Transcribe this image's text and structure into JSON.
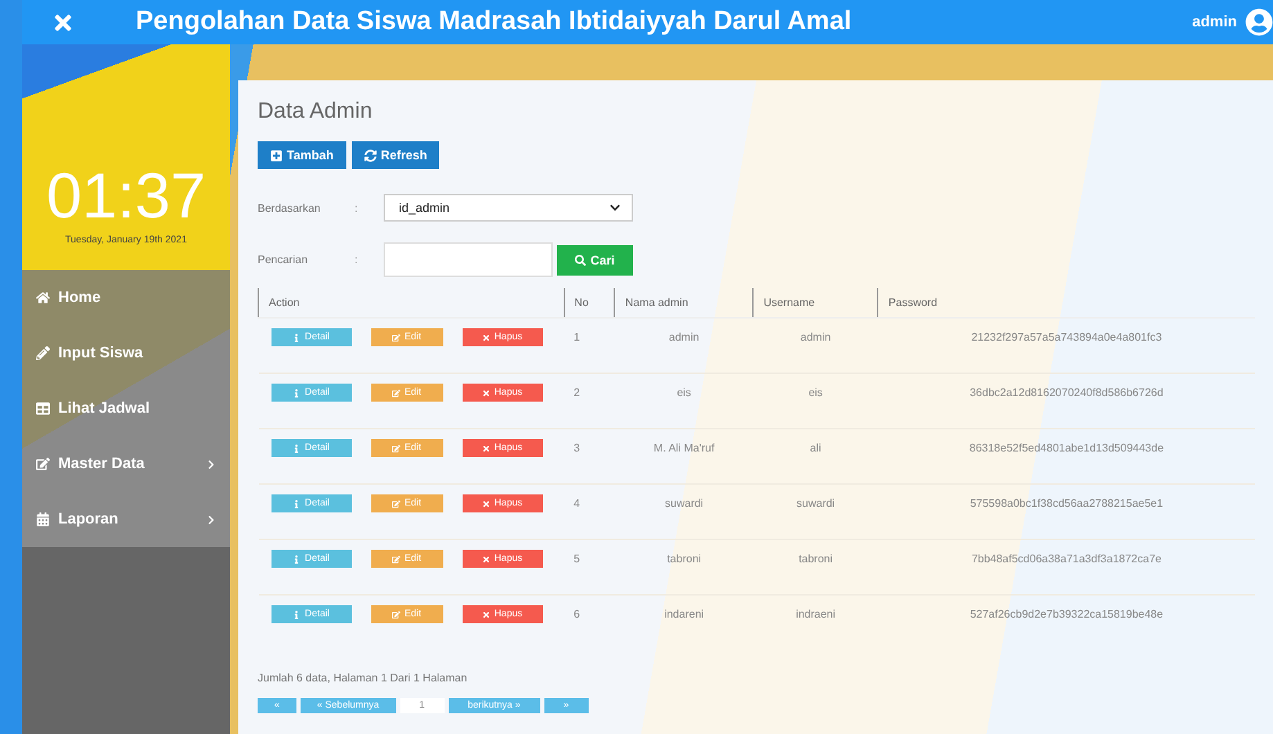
{
  "header": {
    "title": "Pengolahan Data Siswa Madrasah Ibtidaiyyah Darul Amal",
    "user": "admin"
  },
  "sidebar": {
    "clock": {
      "time": "01:37",
      "date": "Tuesday, January 19th 2021"
    },
    "items": [
      {
        "label": "Home",
        "submenu": false
      },
      {
        "label": "Input Siswa",
        "submenu": false
      },
      {
        "label": "Lihat Jadwal",
        "submenu": false
      },
      {
        "label": "Master Data",
        "submenu": true
      },
      {
        "label": "Laporan",
        "submenu": true
      }
    ]
  },
  "page_title": "Data Admin",
  "toolbar": [
    {
      "label": "Tambah",
      "kind": "add"
    },
    {
      "label": "Refresh",
      "kind": "refresh"
    }
  ],
  "filter": {
    "label": "Berdasarkan",
    "separator": ":",
    "value": "id_admin"
  },
  "search": {
    "label": "Pencarian",
    "separator": ":",
    "button": "Cari"
  },
  "table": {
    "columns": [
      "Action",
      "No",
      "Nama admin",
      "Username",
      "Password"
    ],
    "rows": [
      {
        "actions": [
          "Detail",
          "Edit",
          "Hapus"
        ],
        "no": "1",
        "name": "admin",
        "username": "admin",
        "password": "21232f297a57a5a743894a0e4a801fc3"
      },
      {
        "actions": [
          "Detail",
          "Edit",
          "Hapus"
        ],
        "no": "2",
        "name": "eis",
        "username": "eis",
        "password": "36dbc2a12d8162070240f8d586b6726d"
      },
      {
        "actions": [
          "Detail",
          "Edit",
          "Hapus"
        ],
        "no": "3",
        "name": "M. Ali Ma'ruf",
        "username": "ali",
        "password": "86318e52f5ed4801abe1d13d509443de"
      },
      {
        "actions": [
          "Detail",
          "Edit",
          "Hapus"
        ],
        "no": "4",
        "name": "suwardi",
        "username": "suwardi",
        "password": "575598a0bc1f38cd56aa2788215ae5e1"
      },
      {
        "actions": [
          "Detail",
          "Edit",
          "Hapus"
        ],
        "no": "5",
        "name": "tabroni",
        "username": "tabroni",
        "password": "7bb48af5cd06a38a71a3df3a1872ca7e"
      },
      {
        "actions": [
          "Detail",
          "Edit",
          "Hapus"
        ],
        "no": "6",
        "name": "indareni",
        "username": "indraeni",
        "password": "527af26cb9d2e7b39322ca15819be48e"
      }
    ]
  },
  "summary": "Jumlah 6 data, Halaman 1 Dari 1 Halaman",
  "pagination": [
    {
      "label": "«",
      "selected": false
    },
    {
      "label": "« Sebelumnya",
      "selected": false
    },
    {
      "label": "1",
      "selected": true
    },
    {
      "label": "berikutnya »",
      "selected": false
    },
    {
      "label": "»",
      "selected": false
    }
  ]
}
